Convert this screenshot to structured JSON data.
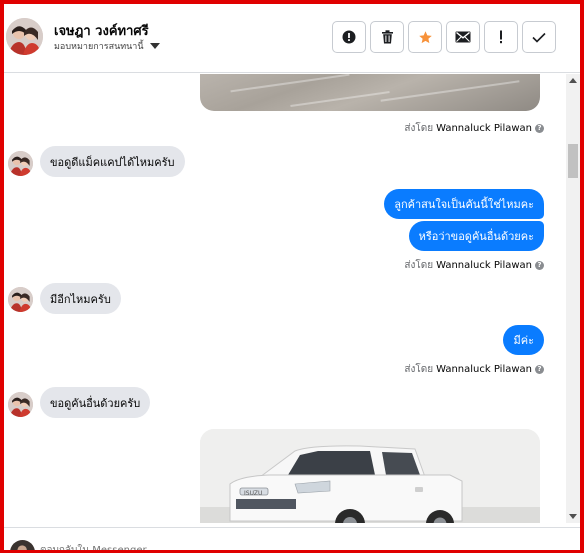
{
  "header": {
    "contact_name": "เจษฎา วงค์ทาศรี",
    "assign_label": "มอบหมายการสนทนานี้",
    "toolbar": [
      {
        "name": "mark-spam-button",
        "icon": "exclamation-circle-icon"
      },
      {
        "name": "delete-button",
        "icon": "trash-icon"
      },
      {
        "name": "star-button",
        "icon": "star-icon"
      },
      {
        "name": "mark-unread-button",
        "icon": "envelope-icon"
      },
      {
        "name": "follow-up-button",
        "icon": "exclamation-icon"
      },
      {
        "name": "mark-done-button",
        "icon": "checkmark-icon"
      }
    ],
    "star_color": "#f7923a"
  },
  "messages": {
    "sent_by_prefix": "ส่งโดย",
    "sender_name": "Wannaluck Pilawan",
    "msg1": "ขอดูดีแม็คแคปได้ไหมครับ",
    "msg2": "ลูกค้าสนใจเป็นคันนี้ใช่ไหมคะ",
    "msg3": "หรือว่าขอดูคันอื่นด้วยคะ",
    "msg4": "มีอีกไหมครับ",
    "msg5": "มีค่ะ",
    "msg6": "ขอดูคันอื่นด้วยครับ"
  },
  "composer": {
    "placeholder": "ตอบกลับใน Messenger..."
  },
  "colors": {
    "outgoing_bubble": "#0a7cff",
    "incoming_bubble": "#e4e6eb",
    "frame_border": "#e00000"
  }
}
